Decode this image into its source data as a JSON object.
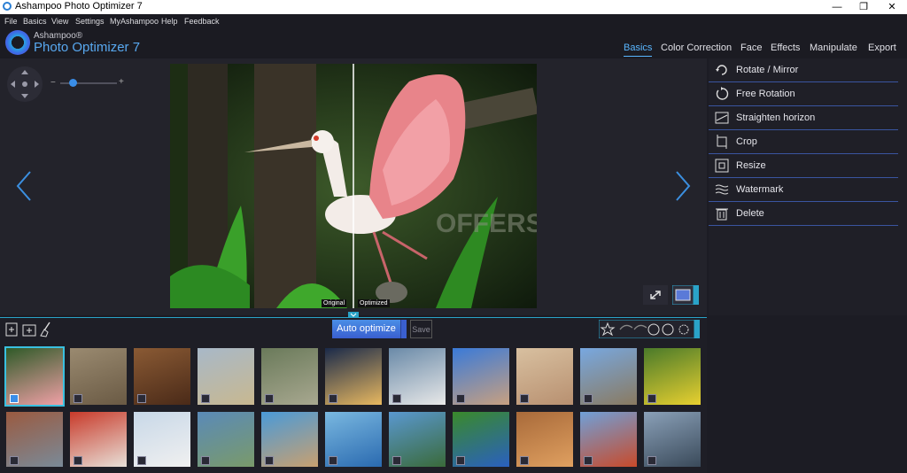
{
  "window": {
    "title": "Ashampoo Photo Optimizer 7",
    "controls": [
      "—",
      "❐",
      "✕"
    ]
  },
  "menu": [
    "File",
    "Basics",
    "View",
    "Settings",
    "MyAshampoo",
    "Help",
    "Feedback"
  ],
  "brand": {
    "line1": "Ashampoo®",
    "line2": "Photo Optimizer 7"
  },
  "tabs": [
    {
      "label": "Basics",
      "active": true
    },
    {
      "label": "Color Correction",
      "active": false
    },
    {
      "label": "Face",
      "active": false
    },
    {
      "label": "Effects",
      "active": false
    },
    {
      "label": "Manipulate",
      "active": false
    },
    {
      "label": "Export",
      "active": false
    }
  ],
  "zoom": {
    "minus": "−",
    "plus": "+",
    "level": 0.22
  },
  "compare": {
    "left": "Original",
    "right": "Optimized"
  },
  "watermark": "OFFERS",
  "tools": [
    {
      "label": "Rotate / Mirror",
      "icon": "rotate-mirror-icon"
    },
    {
      "label": "Free Rotation",
      "icon": "free-rotation-icon"
    },
    {
      "label": "Straighten horizon",
      "icon": "straighten-horizon-icon"
    },
    {
      "label": "Crop",
      "icon": "crop-icon"
    },
    {
      "label": "Resize",
      "icon": "resize-icon"
    },
    {
      "label": "Watermark",
      "icon": "watermark-icon"
    },
    {
      "label": "Delete",
      "icon": "delete-icon"
    }
  ],
  "actions": {
    "auto_optimize": "Auto optimize",
    "save": "Save"
  },
  "colors": {
    "accent": "#2aa3c8",
    "active_tab": "#59b6ff",
    "tool_border": "#3a55a0",
    "auto_btn": "#3a5fd0"
  },
  "thumbnails": {
    "row1": [
      "flamingo",
      "monkey",
      "logs",
      "beach-dunes",
      "bird-grass",
      "city-night",
      "egret",
      "woman-hat",
      "desert",
      "eiffel-tower",
      "yellow-flowers"
    ],
    "row2": [
      "canal-buildings",
      "motorbike-rider",
      "lighthouse",
      "coast-town",
      "horse-wall",
      "blue-car",
      "green-truck",
      "parrot",
      "cat",
      "golden-gate",
      "skyscrapers"
    ]
  }
}
